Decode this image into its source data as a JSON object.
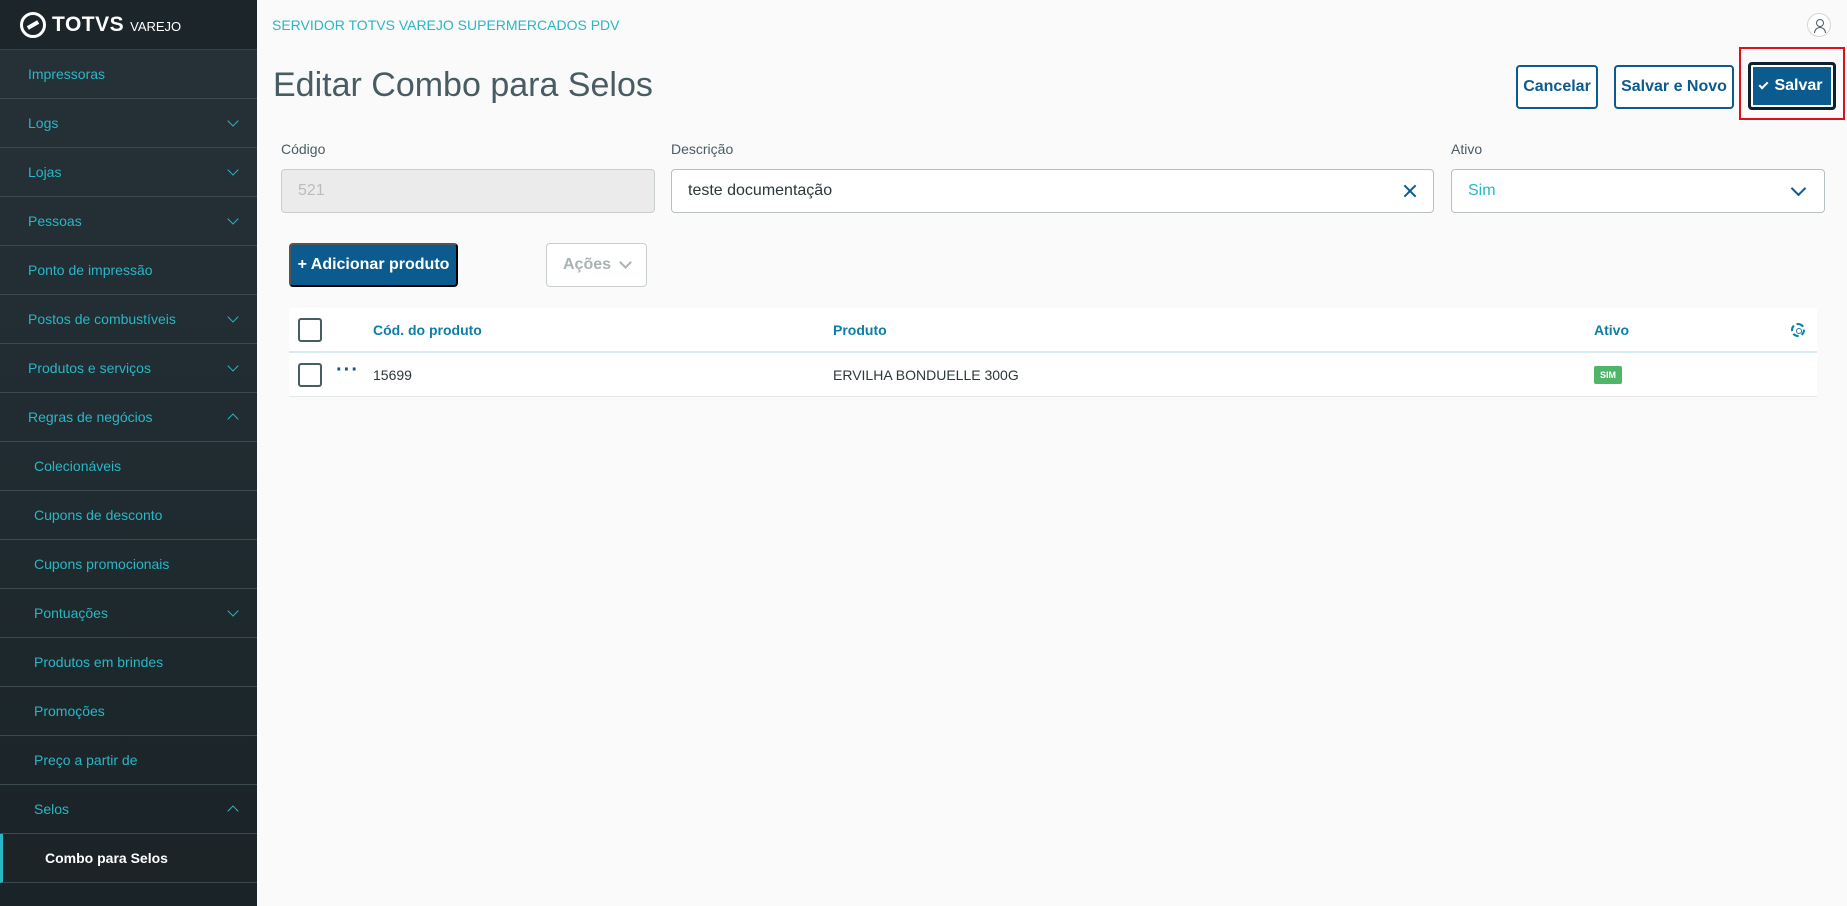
{
  "brand": {
    "name": "TOTVS",
    "sub": "VAREJO"
  },
  "header": {
    "server_title": "SERVIDOR TOTVS VAREJO SUPERMERCADOS PDV"
  },
  "sidebar": {
    "items": [
      {
        "label": "Impressoras"
      },
      {
        "label": "Logs"
      },
      {
        "label": "Lojas"
      },
      {
        "label": "Pessoas"
      },
      {
        "label": "Ponto de impressão"
      },
      {
        "label": "Postos de combustíveis"
      },
      {
        "label": "Produtos e serviços"
      },
      {
        "label": "Regras de negócios"
      },
      {
        "label": "Colecionáveis"
      },
      {
        "label": "Cupons de desconto"
      },
      {
        "label": "Cupons promocionais"
      },
      {
        "label": "Pontuações"
      },
      {
        "label": "Produtos em brindes"
      },
      {
        "label": "Promoções"
      },
      {
        "label": "Preço a partir de"
      },
      {
        "label": "Selos"
      },
      {
        "label": "Combo para Selos"
      }
    ]
  },
  "page": {
    "title": "Editar Combo para Selos"
  },
  "toolbar": {
    "cancel_label": "Cancelar",
    "save_new_label": "Salvar e Novo",
    "save_label": "Salvar"
  },
  "form": {
    "codigo": {
      "label": "Código",
      "value": "521"
    },
    "descricao": {
      "label": "Descrição",
      "value": "teste documentação"
    },
    "ativo": {
      "label": "Ativo",
      "value": "Sim"
    }
  },
  "actions": {
    "add_label": "+ Adicionar produto",
    "actions_label": "Ações"
  },
  "table": {
    "columns": [
      "Cód. do produto",
      "Produto",
      "Ativo"
    ],
    "rows": [
      {
        "codigo": "15699",
        "produto": "ERVILHA BONDUELLE 300G",
        "ativo": "SIM"
      }
    ]
  },
  "colors": {
    "primary": "#0c5b8e",
    "accent": "#29b6c5",
    "sidebar_bg": "#263238",
    "success": "#4fb668",
    "highlight": "#e0101a"
  }
}
